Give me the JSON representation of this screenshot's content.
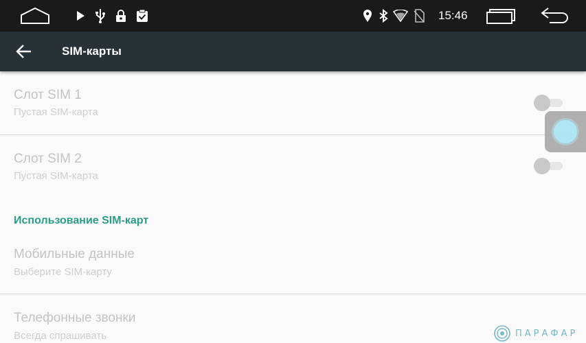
{
  "status_bar": {
    "time": "15:46",
    "icons": [
      "home-icon",
      "play-icon",
      "usb-icon",
      "lock-icon",
      "clipboard-check-icon",
      "location-icon",
      "bluetooth-icon",
      "wifi-icon",
      "no-sim-icon",
      "recent-apps-icon",
      "back-icon"
    ]
  },
  "toolbar": {
    "title": "SIM-карты",
    "back_icon": "arrow-left-icon"
  },
  "settings": {
    "sim1": {
      "title": "Слот SIM 1",
      "summary": "Пустая SIM-карта",
      "enabled": false
    },
    "sim2": {
      "title": "Слот SIM 2",
      "summary": "Пустая SIM-карта",
      "enabled": false
    },
    "section_title": "Использование SIM-карт",
    "mobile_data": {
      "title": "Мобильные данные",
      "summary": "Выберите SIM-карту"
    },
    "phone_calls": {
      "title": "Телефонные звонки",
      "summary": "Всегда спрашивать"
    }
  },
  "watermark": {
    "text": "ПАРАФАР"
  },
  "colors": {
    "toolbar": "#263238",
    "status_bar": "#1a1a1a",
    "accent": "#2a9d87",
    "background": "#fafafa"
  }
}
